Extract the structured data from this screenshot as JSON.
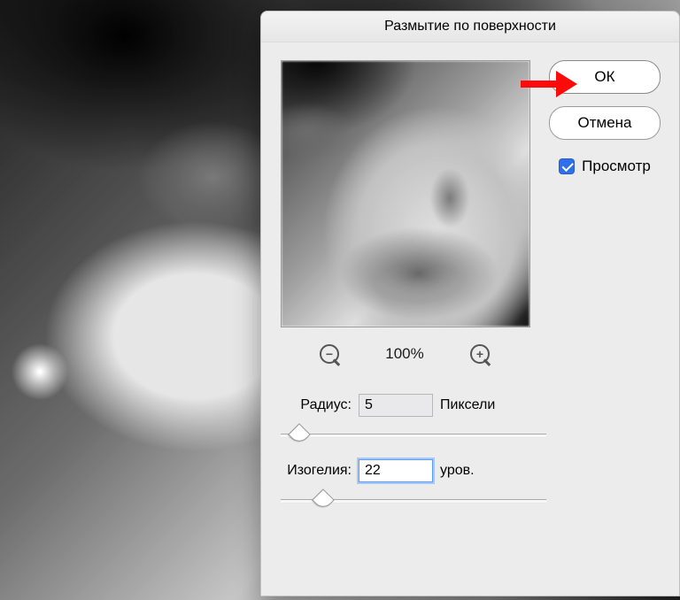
{
  "dialog": {
    "title": "Размытие по поверхности",
    "ok_label": "ОК",
    "cancel_label": "Отмена",
    "preview_label": "Просмотр",
    "preview_checked": true,
    "zoom_label": "100%",
    "radius": {
      "label": "Радиус:",
      "value": "5",
      "unit": "Пиксели",
      "slider_pos_pct": 4
    },
    "threshold": {
      "label": "Изогелия:",
      "value": "22",
      "unit": "уров.",
      "slider_pos_pct": 13
    }
  }
}
